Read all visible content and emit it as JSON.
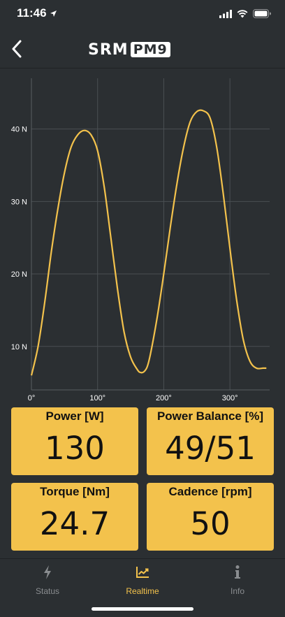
{
  "status_bar": {
    "time": "11:46",
    "icons": [
      "location-arrow-icon",
      "cellular-signal-icon",
      "wifi-icon",
      "battery-icon"
    ]
  },
  "header": {
    "logo_text": "SRM",
    "logo_badge": "PM9",
    "back_icon": "chevron-left-icon"
  },
  "chart_data": {
    "type": "line",
    "title": "",
    "xlabel": "",
    "ylabel": "",
    "x_ticks": [
      "0°",
      "100°",
      "200°",
      "300°"
    ],
    "y_ticks": [
      "10 N",
      "20 N",
      "30 N",
      "40 N"
    ],
    "xlim": [
      0,
      360
    ],
    "ylim": [
      4,
      47
    ],
    "grid": true,
    "line_color": "#f3c24c",
    "series": [
      {
        "x": [
          0,
          10,
          20,
          30,
          40,
          50,
          60,
          70,
          80,
          90,
          100,
          110,
          120,
          130,
          140,
          150,
          160,
          165,
          170,
          175,
          180,
          190,
          200,
          210,
          220,
          230,
          240,
          250,
          260,
          270,
          280,
          290,
          300,
          310,
          320,
          330,
          340,
          350,
          355
        ],
        "y": [
          6,
          10,
          16,
          23,
          29,
          34,
          37.5,
          39.2,
          39.8,
          39.2,
          37,
          32,
          25,
          18,
          12,
          8.5,
          6.8,
          6.4,
          6.5,
          7.2,
          9,
          14,
          20,
          26.5,
          32.5,
          37.5,
          41,
          42.4,
          42.5,
          41.5,
          37.5,
          31,
          23.5,
          16.5,
          11,
          8,
          7,
          7,
          7
        ]
      }
    ]
  },
  "tiles": [
    {
      "label": "Power [W]",
      "value": "130"
    },
    {
      "label": "Power Balance [%]",
      "value": "49/51"
    },
    {
      "label": "Torque [Nm]",
      "value": "24.7"
    },
    {
      "label": "Cadence [rpm]",
      "value": "50"
    }
  ],
  "tab_bar": {
    "active_color": "#f3c24c",
    "inactive_color": "#8a8d90",
    "tabs": [
      {
        "label": "Status",
        "icon": "lightning-bolt-icon"
      },
      {
        "label": "Realtime",
        "icon": "line-chart-icon"
      },
      {
        "label": "Info",
        "icon": "info-icon"
      }
    ]
  }
}
